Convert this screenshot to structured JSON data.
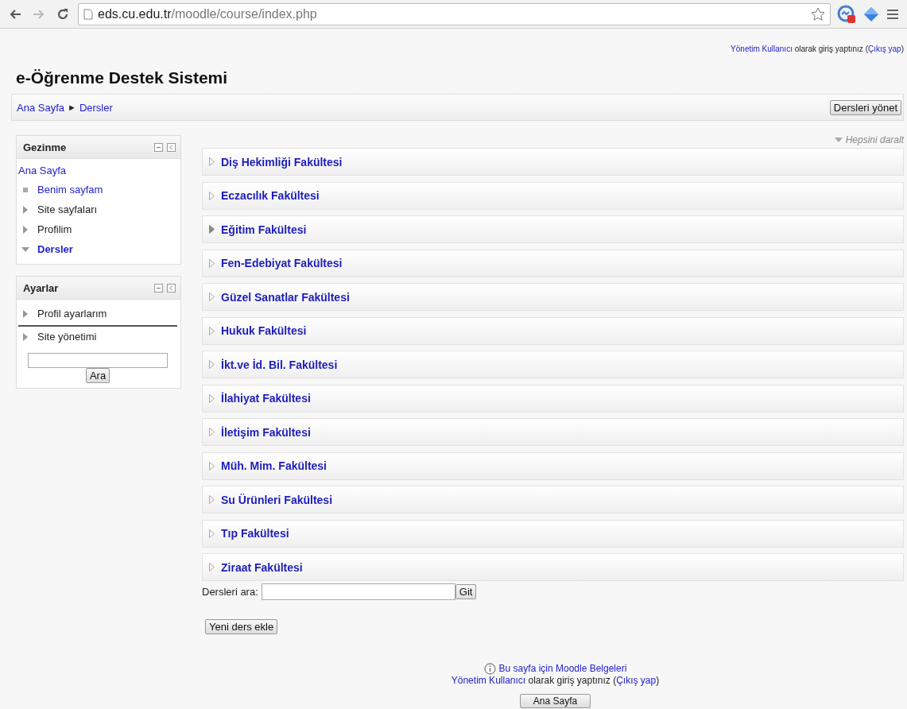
{
  "browser": {
    "url_host": "eds.cu.edu.tr",
    "url_path": "/moodle/course/index.php"
  },
  "header": {
    "site_title": "e-Öğrenme Destek Sistemi",
    "login": {
      "user": "Yönetim Kullanıcı",
      "middle": " olarak giriş yaptınız (",
      "logout": "Çıkış yap",
      "end": ")"
    }
  },
  "breadcrumb": {
    "items": [
      "Ana Sayfa",
      "Dersler"
    ],
    "separator": "►",
    "button": "Dersleri yönet"
  },
  "navigation": {
    "title": "Gezinme",
    "home": "Ana Sayfa",
    "items": [
      {
        "label": "Benim sayfam",
        "kind": "leaf",
        "current": false
      },
      {
        "label": "Site sayfaları",
        "kind": "collapsed",
        "current": false
      },
      {
        "label": "Profilim",
        "kind": "collapsed",
        "current": false
      },
      {
        "label": "Dersler",
        "kind": "expanded",
        "current": true
      }
    ]
  },
  "settings": {
    "title": "Ayarlar",
    "items": [
      {
        "label": "Profil ayarlarım"
      },
      {
        "label": "Site yönetimi"
      }
    ],
    "search_button": "Ara"
  },
  "collapse_all": "Hepsini daralt",
  "categories": [
    {
      "name": "Diş Hekimliği Fakültesi",
      "has_children": false
    },
    {
      "name": "Eczacılık Fakültesi",
      "has_children": false
    },
    {
      "name": "Eğitim Fakültesi",
      "has_children": true
    },
    {
      "name": "Fen-Edebiyat Fakültesi",
      "has_children": false
    },
    {
      "name": "Güzel Sanatlar Fakültesi",
      "has_children": false
    },
    {
      "name": "Hukuk Fakültesi",
      "has_children": false
    },
    {
      "name": "İkt.ve İd. Bil. Fakültesi",
      "has_children": false
    },
    {
      "name": "İlahiyat Fakültesi",
      "has_children": false
    },
    {
      "name": "İletişim Fakültesi",
      "has_children": false
    },
    {
      "name": "Müh. Mim. Fakültesi",
      "has_children": false
    },
    {
      "name": "Su Ürünleri Fakültesi",
      "has_children": false
    },
    {
      "name": "Tıp Fakültesi",
      "has_children": false
    },
    {
      "name": "Ziraat Fakültesi",
      "has_children": false
    }
  ],
  "course_search": {
    "label": "Dersleri ara:",
    "button": "Git"
  },
  "add_course_button": "Yeni ders ekle",
  "footer": {
    "docs_link": "Bu sayfa için Moodle Belgeleri",
    "login": {
      "user": "Yönetim Kullanıcı",
      "middle": " olarak giriş yaptınız (",
      "logout": "Çıkış yap",
      "end": ")"
    },
    "home_button": "Ana Sayfa"
  }
}
